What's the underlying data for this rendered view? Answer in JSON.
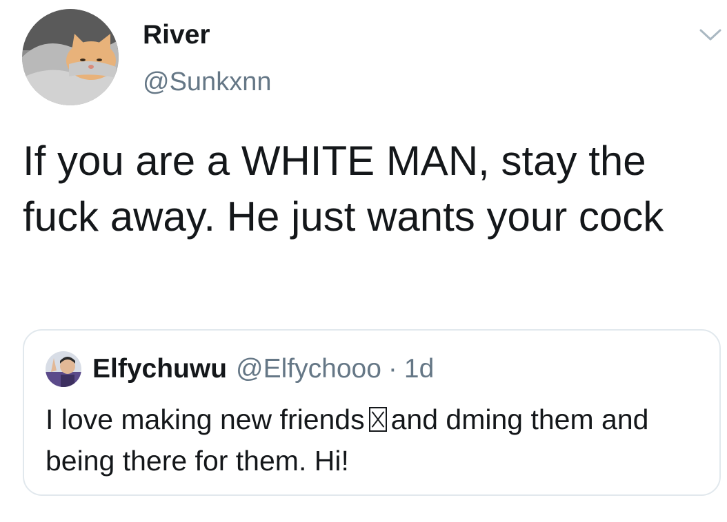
{
  "tweet": {
    "author": {
      "name": "River",
      "handle": "@Sunkxnn",
      "avatar_icon": "cat-photo-avatar"
    },
    "text": "If you are a WHITE MAN, stay the fuck away. He just wants your cock",
    "menu_icon": "chevron-down-icon"
  },
  "quote": {
    "author": {
      "name": "Elfychuwu",
      "handle": "@Elfychooo",
      "avatar_icon": "person-photo-avatar"
    },
    "separator": "·",
    "time": "1d",
    "text_before_emoji": "I love making new friends",
    "emoji_icon": "missing-glyph-box",
    "text_after_emoji": "and dming them and being there for them. Hi!"
  },
  "colors": {
    "text_primary": "#14171a",
    "text_secondary": "#657786",
    "border": "#e1e8ed",
    "caret": "#aab8c2"
  }
}
